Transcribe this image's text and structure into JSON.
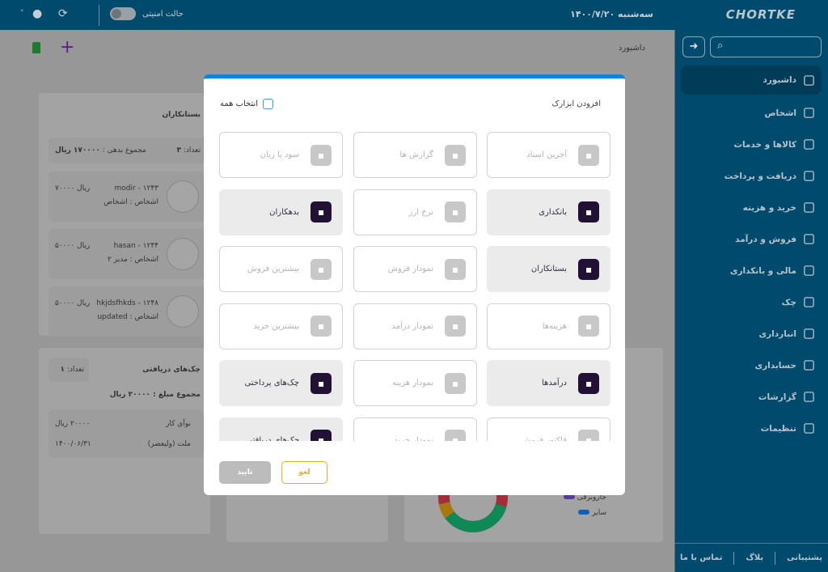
{
  "header": {
    "logo": "CHORTKE",
    "date": "سه‌شنبه ۱۴۰۰/۷/۲۰",
    "safe_mode_label": "حالت امنیتی",
    "safe_mode_on": false
  },
  "sidebar": {
    "search_placeholder": "",
    "items": [
      {
        "label": "داشبورد",
        "icon": "grid-icon",
        "active": true
      },
      {
        "label": "اشخاص",
        "icon": "people-icon"
      },
      {
        "label": "کالاها و خدمات",
        "icon": "box-icon"
      },
      {
        "label": "دریافت و پرداخت",
        "icon": "loader-icon"
      },
      {
        "label": "خرید و هزینه",
        "icon": "cart-icon"
      },
      {
        "label": "فروش و درآمد",
        "icon": "shop-icon"
      },
      {
        "label": "مالی و بانکداری",
        "icon": "bank-icon"
      },
      {
        "label": "چک",
        "icon": "bank-icon"
      },
      {
        "label": "انبارداری",
        "icon": "warehouse-icon"
      },
      {
        "label": "حسابداری",
        "icon": "calculator-icon"
      },
      {
        "label": "گزارشات",
        "icon": "chart-icon"
      },
      {
        "label": "تنظیمات",
        "icon": "gear-icon"
      }
    ],
    "footer": [
      "پشتیبانی",
      "بلاگ",
      "تماس با ما"
    ]
  },
  "breadcrumb": "داشبورد",
  "creditors": {
    "title": "بستانکاران",
    "count_label": "تعداد:",
    "count": "۳",
    "total_label": "مجموع بدهی :",
    "total": "۱۷۰۰۰۰ ریال",
    "rows": [
      {
        "name": "modir - ۱۲۴۳",
        "amount": "ریال ۷۰۰۰۰",
        "type": "اشخاص : اشخاص"
      },
      {
        "name": "hasan - ۱۲۴۴",
        "amount": "ریال ۵۰۰۰۰",
        "type": "اشخاص : مدیر ۲"
      },
      {
        "name": "hkjdsfhkds - ۱۲۴۸",
        "amount": "ریال ۵۰۰۰۰",
        "type": "اشخاص : updated"
      }
    ]
  },
  "received_checks": {
    "title": "چک‌های دریافتی",
    "count_label": "تعداد:",
    "count": "۱",
    "total": "مجموع مبلغ : ۲۰۰۰۰ ریال",
    "row": {
      "name": "نوآی کار",
      "amount": "۲۰۰۰۰ ریال",
      "bank": "ملت (ولیعصر)",
      "date": "۱۴۰۰/۰۶/۳۱"
    }
  },
  "donut": {
    "legend": [
      {
        "label": "جاروبرقی",
        "color": "#5b3a9e"
      },
      {
        "label": "سایر",
        "color": "#0a62b8"
      }
    ]
  },
  "modal": {
    "title": "افزودن ابزارک",
    "select_all": "انتخاب همه",
    "ok": "تایید",
    "cancel": "لغو",
    "tiles": [
      {
        "label": "آخرین اسناد",
        "on": false,
        "icon": "folder-icon"
      },
      {
        "label": "گزارش ها",
        "on": false,
        "icon": "bar-chart-icon"
      },
      {
        "label": "سود یا زیان",
        "on": false,
        "icon": "profit-loss-icon"
      },
      {
        "label": "بانکداری",
        "on": true,
        "icon": "bank-icon"
      },
      {
        "label": "نرخ ارز",
        "on": false,
        "icon": "percent-badge-icon"
      },
      {
        "label": "بدهکاران",
        "on": true,
        "icon": "trend-icon"
      },
      {
        "label": "بستانکاران",
        "on": true,
        "icon": "trend-icon"
      },
      {
        "label": "نمودار فروش",
        "on": false,
        "icon": "sales-chart-icon"
      },
      {
        "label": "بیشترین فروش",
        "on": false,
        "icon": "dollar-up-icon"
      },
      {
        "label": "هزینه‌ها",
        "on": false,
        "icon": "file-upload-icon"
      },
      {
        "label": "نمودار درآمد",
        "on": false,
        "icon": "income-chart-icon"
      },
      {
        "label": "بیشترین خرید",
        "on": false,
        "icon": "dollar-down-icon"
      },
      {
        "label": "درآمدها",
        "on": true,
        "icon": "file-download-icon"
      },
      {
        "label": "نمودار هزینه",
        "on": false,
        "icon": "pie-icon"
      },
      {
        "label": "چک‌های پرداختی",
        "on": true,
        "icon": "check-out-icon"
      },
      {
        "label": "فاکتور فروش",
        "on": false,
        "icon": "invoice-icon"
      },
      {
        "label": "نمودار خرید",
        "on": false,
        "icon": "pie-icon"
      },
      {
        "label": "چک‌های دریافتی",
        "on": true,
        "icon": "check-in-icon"
      }
    ]
  }
}
